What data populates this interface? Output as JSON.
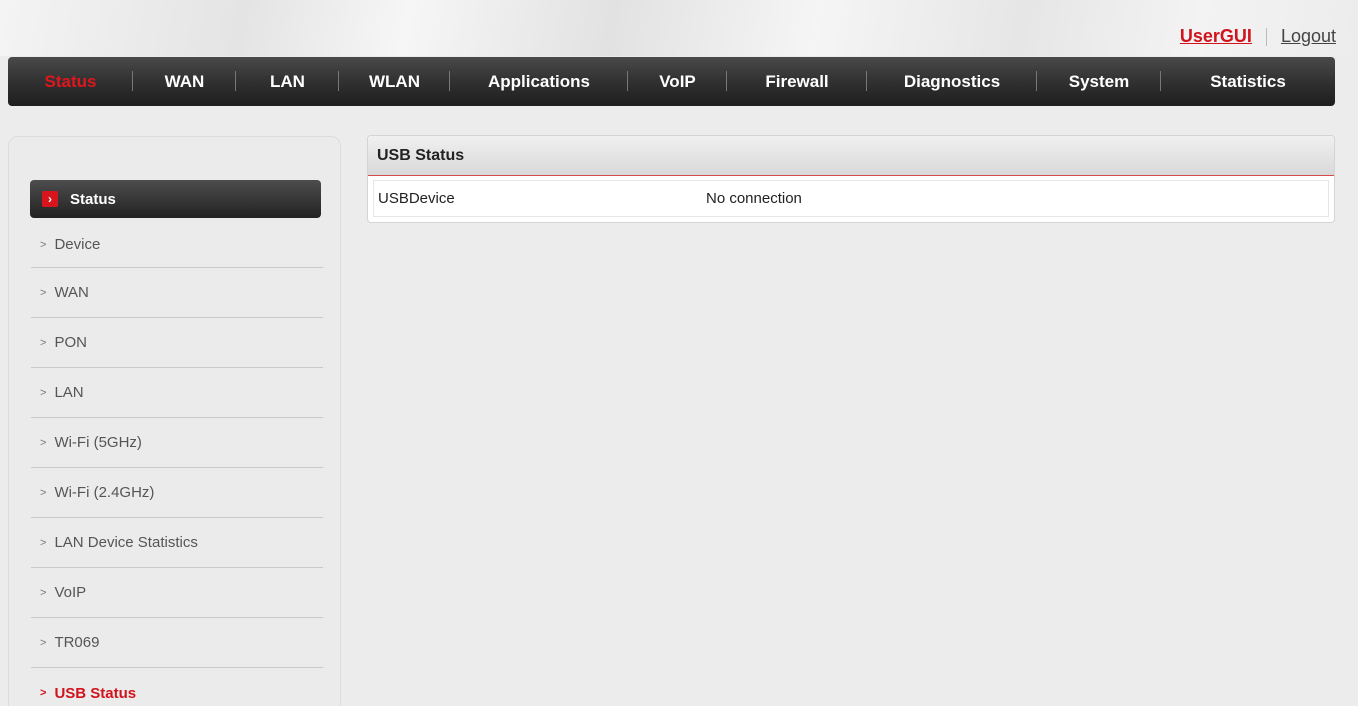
{
  "header": {
    "user_link": "UserGUI",
    "logout_link": "Logout"
  },
  "nav": {
    "items": [
      "Status",
      "WAN",
      "LAN",
      "WLAN",
      "Applications",
      "VoIP",
      "Firewall",
      "Diagnostics",
      "System",
      "Statistics"
    ],
    "active": "Status"
  },
  "sidebar": {
    "heading": "Status",
    "items": [
      "Device",
      "WAN",
      "PON",
      "LAN",
      "Wi-Fi (5GHz)",
      "Wi-Fi (2.4GHz)",
      "LAN Device Statistics",
      "VoIP",
      "TR069",
      "USB Status"
    ],
    "selected": "USB Status"
  },
  "panel": {
    "title": "USB Status",
    "rows": [
      {
        "label": "USBDevice",
        "value": "No connection"
      }
    ]
  },
  "colors": {
    "accent_red": "#d0131d",
    "nav_dark": "#2a2a2a",
    "background": "#ececec"
  }
}
